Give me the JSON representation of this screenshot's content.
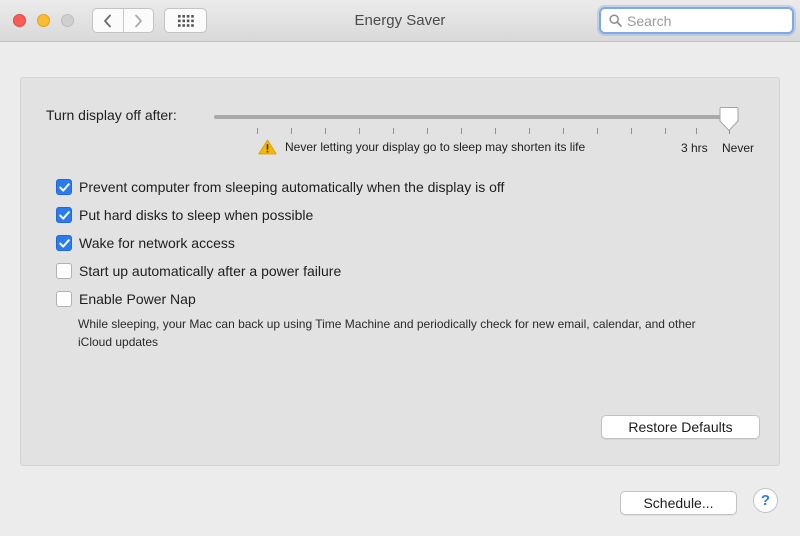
{
  "window": {
    "title": "Energy Saver",
    "search_placeholder": "Search"
  },
  "icons": {
    "back": "chevron-left-icon",
    "forward": "chevron-right-icon",
    "show_all": "grid-icon",
    "search": "search-icon",
    "warning": "warning-icon",
    "help": "help-icon"
  },
  "display_sleep": {
    "label": "Turn display off after:",
    "value": "Never",
    "warning": "Never letting your display go to sleep may shorten its life",
    "tick_labels": {
      "three_hours": "3 hrs",
      "never": "Never"
    }
  },
  "options": [
    {
      "label": "Prevent computer from sleeping automatically when the display is off",
      "checked": true
    },
    {
      "label": "Put hard disks to sleep when possible",
      "checked": true
    },
    {
      "label": "Wake for network access",
      "checked": true
    },
    {
      "label": "Start up automatically after a power failure",
      "checked": false
    },
    {
      "label": "Enable Power Nap",
      "checked": false,
      "description": "While sleeping, your Mac can back up using Time Machine and periodically check for new email, calendar, and other iCloud updates"
    }
  ],
  "buttons": {
    "restore_defaults": "Restore Defaults",
    "schedule": "Schedule...",
    "help": "?"
  },
  "colors": {
    "accent": "#2b7bf0",
    "warning": "#f5b800"
  }
}
